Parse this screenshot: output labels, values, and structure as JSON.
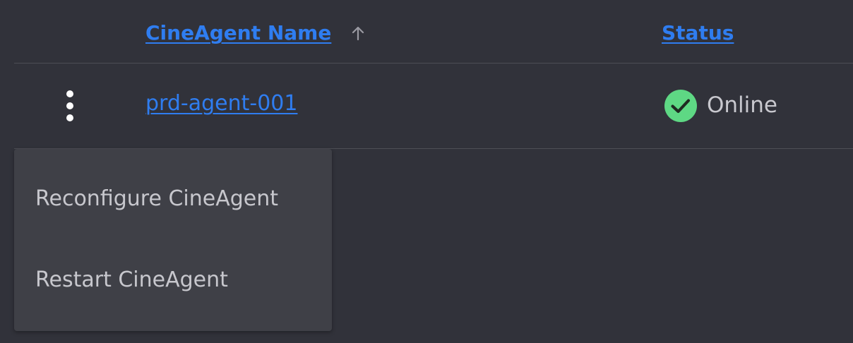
{
  "table": {
    "headers": {
      "name": "CineAgent Name",
      "status": "Status",
      "sort_icon": "arrow-up-icon"
    },
    "rows": [
      {
        "name": "prd-agent-001",
        "status": "Online",
        "status_icon": "check-circle-icon",
        "status_color": "#5ed884"
      }
    ]
  },
  "context_menu": {
    "items": [
      {
        "label": "Reconfigure CineAgent"
      },
      {
        "label": "Restart CineAgent"
      }
    ]
  },
  "colors": {
    "background": "#31323a",
    "link": "#2f7df0",
    "menu_background": "#3f4047",
    "online": "#5ed884"
  }
}
